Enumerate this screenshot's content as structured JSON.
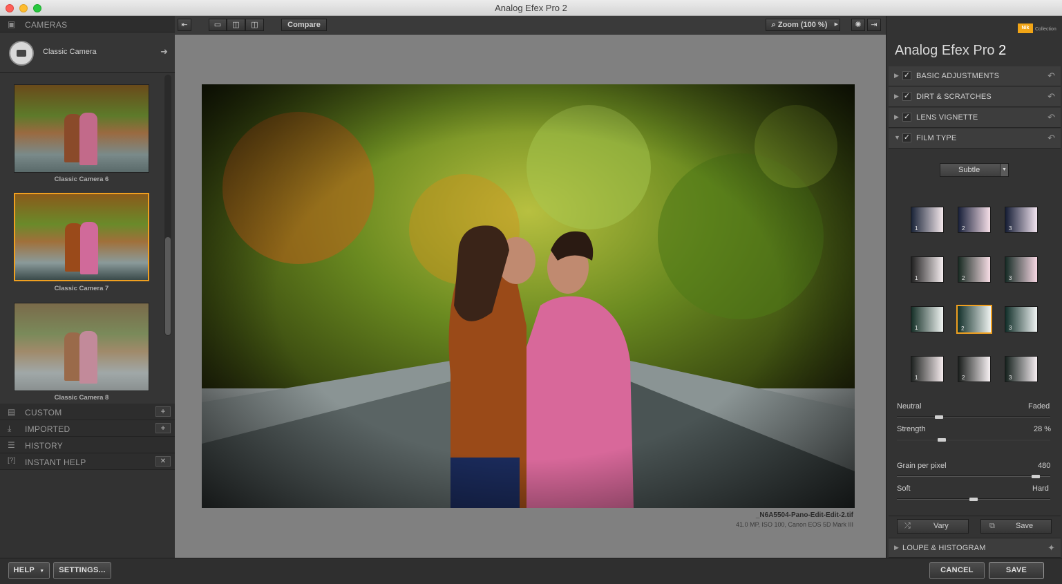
{
  "window": {
    "title": "Analog Efex Pro 2"
  },
  "left": {
    "cameras_label": "CAMERAS",
    "current_camera": "Classic Camera",
    "thumbs": [
      {
        "label": "Classic Camera 6"
      },
      {
        "label": "Classic Camera 7",
        "selected": true
      },
      {
        "label": "Classic Camera 8"
      }
    ],
    "sections": [
      {
        "label": "CUSTOM",
        "action": "+"
      },
      {
        "label": "IMPORTED",
        "action": "+"
      },
      {
        "label": "HISTORY",
        "action": ""
      },
      {
        "label": "INSTANT HELP",
        "action": "✕"
      }
    ]
  },
  "toolbar": {
    "compare_label": "Compare",
    "zoom_label": "Zoom (100 %)"
  },
  "image": {
    "filename": "_N6A5504-Pano-Edit-Edit-2.tif",
    "meta": "41.0 MP, ISO 100, Canon EOS 5D Mark III"
  },
  "right": {
    "brand_logo": "Nik",
    "brand_logo_sub": "Collection",
    "product_title": "Analog Efex Pro",
    "product_version": "2",
    "accordion": [
      {
        "label": "BASIC ADJUSTMENTS",
        "checked": true,
        "open": false
      },
      {
        "label": "DIRT & SCRATCHES",
        "checked": true,
        "open": false
      },
      {
        "label": "LENS VIGNETTE",
        "checked": true,
        "open": false
      },
      {
        "label": "FILM TYPE",
        "checked": true,
        "open": true
      }
    ],
    "film_preset": "Subtle",
    "swatch_numbers": [
      "1",
      "2",
      "3"
    ],
    "sliders": {
      "tone_left": "Neutral",
      "tone_right": "Faded",
      "tone_value": 0.26,
      "strength_label": "Strength",
      "strength_value": "28 %",
      "strength_level": 0.28,
      "grain_label": "Grain per pixel",
      "grain_value": "480",
      "grain_level": 0.93,
      "soft_label": "Soft",
      "hard_label": "Hard",
      "soft_level": 0.5
    },
    "vary_label": "Vary",
    "save_label": "Save",
    "loupe_label": "LOUPE & HISTOGRAM"
  },
  "bottom": {
    "help_label": "HELP",
    "settings_label": "SETTINGS...",
    "cancel_label": "CANCEL",
    "save_label": "SAVE"
  },
  "colors": {
    "accent": "#f0a020"
  }
}
